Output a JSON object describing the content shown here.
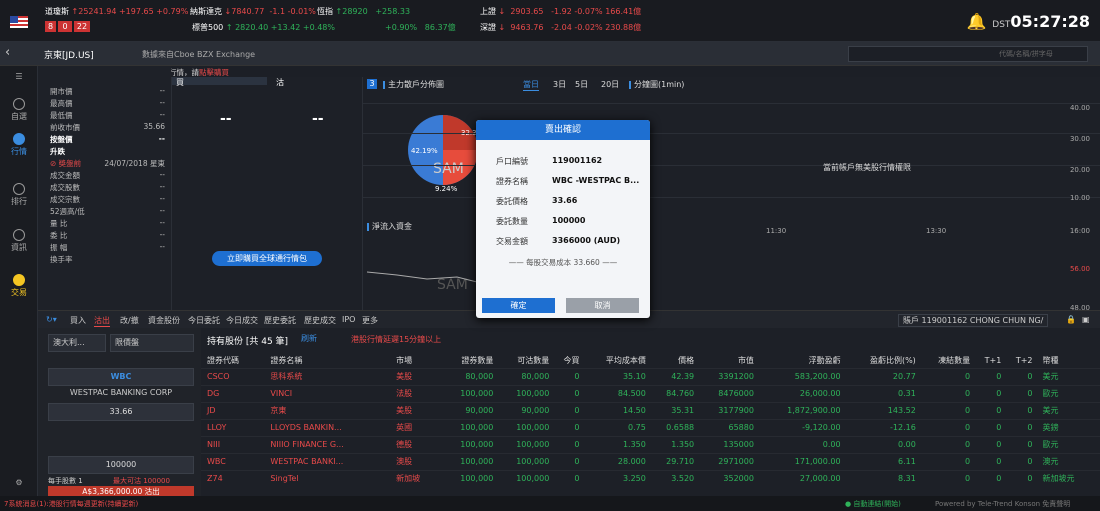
{
  "ticker": [
    {
      "name": "道瓊斯",
      "value": "25241.94",
      "chg": "+197.65",
      "pct": "+0.79%",
      "dir": "up"
    },
    {
      "name": "納斯達克",
      "value": "7840.77",
      "chg": "-1.1",
      "pct": "-0.01%",
      "dir": "dn"
    },
    {
      "name": "恆指",
      "value": "28920",
      "chg": "+258.33",
      "pct": "+0.90%",
      "dir": "up"
    },
    {
      "name": "上證",
      "value": "2903.65",
      "chg": "-1.92",
      "pct": "-0.07%",
      "amt": "166.41億",
      "dir": "dn"
    },
    {
      "name": "標普500",
      "value": "2820.40",
      "chg": "+13.42",
      "pct": "+0.48%",
      "dir": "up"
    },
    {
      "name": "",
      "value": "",
      "chg": "",
      "pct": "",
      "amt": "86.37億",
      "dir": "up"
    },
    {
      "name": "深證",
      "value": "9463.76",
      "chg": "-2.04",
      "pct": "-0.02%",
      "amt": "230.88億",
      "dir": "dn"
    }
  ],
  "counters": [
    "8",
    "0",
    "22"
  ],
  "clock": {
    "zone": "DST",
    "time": "05:27:28"
  },
  "stock": {
    "title": "京東[JD.US]",
    "source": "數據來自Cboe BZX Exchange",
    "search_placeholder": "代碼/名稱/拼字母"
  },
  "nav": [
    {
      "label": "自選"
    },
    {
      "label": "行情"
    },
    {
      "label": "排行"
    },
    {
      "label": "資訊"
    },
    {
      "label": "交易"
    }
  ],
  "warning": "當前帳戶無美股行情權限，如需實時行情，請",
  "warning_link": "點擊購買",
  "quote": [
    {
      "label": "開市價",
      "value": "--"
    },
    {
      "label": "最高價",
      "value": "--"
    },
    {
      "label": "最低價",
      "value": "--"
    },
    {
      "label": "前收市價",
      "value": "35.66"
    },
    {
      "label": "按盤價",
      "value": "--"
    },
    {
      "label": "升跌",
      "value": ""
    },
    {
      "label": "⊘ 獎盤前",
      "value": "24/07/2018 星東"
    },
    {
      "label": "成交金額",
      "value": "--"
    },
    {
      "label": "成交股數",
      "value": "--"
    },
    {
      "label": "成交宗數",
      "value": "--"
    },
    {
      "label": "52週高/低",
      "value": "--"
    },
    {
      "label": "量 比",
      "value": "--"
    },
    {
      "label": "委 比",
      "value": "--"
    },
    {
      "label": "振 幅",
      "value": "--"
    },
    {
      "label": "換手率",
      "value": ""
    }
  ],
  "book": {
    "buy": "買",
    "sell": "沽",
    "buy_price": "--",
    "sell_price": "--",
    "link": "立即購買全球通行情包"
  },
  "charts": {
    "main_title": "主力散戶分佈圖",
    "periods": [
      "當日",
      "3日",
      "5日",
      "20日"
    ],
    "flow_title": "分鐘圖(1min)",
    "pie": [
      {
        "label": "42.19%",
        "value": 42.19
      },
      {
        "label": "32.3",
        "value": 32.3
      },
      {
        "label": "9.24%",
        "value": 9.24
      }
    ],
    "net_title": "淨流入資金",
    "no_perm": "當前帳戶無美股行情權限",
    "yticks": [
      "40.00",
      "30.00",
      "20.00",
      "10.00",
      "16:00",
      "56.00",
      "48.00"
    ],
    "xticks": [
      "11:30",
      "13:30"
    ],
    "watermark": "SAM"
  },
  "modal": {
    "title": "賣出確認",
    "rows": [
      {
        "label": "戶口編號",
        "value": "119001162"
      },
      {
        "label": "證券名稱",
        "value": "WBC -WESTPAC B..."
      },
      {
        "label": "委託價格",
        "value": "33.66"
      },
      {
        "label": "委託數量",
        "value": "100000"
      },
      {
        "label": "交易金額",
        "value": "3366000 (AUD)"
      }
    ],
    "fee": "每股交易成本 33.660",
    "ok": "確定",
    "cancel": "取消"
  },
  "tabs": [
    "買入",
    "沽出",
    "改/撤",
    "資金股份",
    "今日委託",
    "今日成交",
    "歷史委託",
    "歷史成交",
    "IPO",
    "更多"
  ],
  "account": "賬戶 119001162 CHONG CHUN NG/",
  "entry": {
    "market": "澳大利...",
    "order_type": "限價盤",
    "code": "WBC",
    "name": "WESTPAC BANKING CORP",
    "price": "33.66",
    "qty": "100000",
    "lot": "每手股數 1",
    "max": "最大可沽 100000",
    "submit": "A$3,366,000.00 沽出"
  },
  "holdings": {
    "title": "持有股份 [共 45 筆]",
    "refresh": "刷新",
    "note": "港股行情延遲15分鐘以上",
    "headers": [
      "證券代碼",
      "證券名稱",
      "市場",
      "證券數量",
      "可沽數量",
      "今買",
      "平均成本價",
      "價格",
      "市值",
      "浮動盈虧",
      "盈虧比例(%)",
      "凍結數量",
      "T+1",
      "T+2",
      "幣種"
    ],
    "rows": [
      [
        "CSCO",
        "思科系統",
        "美股",
        "80,000",
        "80,000",
        "0",
        "35.10",
        "42.39",
        "3391200",
        "583,200.00",
        "20.77",
        "0",
        "0",
        "0",
        "美元"
      ],
      [
        "DG",
        "VINCI",
        "法股",
        "100,000",
        "100,000",
        "0",
        "84.500",
        "84.760",
        "8476000",
        "26,000.00",
        "0.31",
        "0",
        "0",
        "0",
        "歐元"
      ],
      [
        "JD",
        "京東",
        "美股",
        "90,000",
        "90,000",
        "0",
        "14.50",
        "35.31",
        "3177900",
        "1,872,900.00",
        "143.52",
        "0",
        "0",
        "0",
        "美元"
      ],
      [
        "LLOY",
        "LLOYDS BANKIN...",
        "英國",
        "100,000",
        "100,000",
        "0",
        "0.75",
        "0.6588",
        "65880",
        "-9,120.00",
        "-12.16",
        "0",
        "0",
        "0",
        "英鎊"
      ],
      [
        "NIII",
        "NIIIO FINANCE G...",
        "德股",
        "100,000",
        "100,000",
        "0",
        "1.350",
        "1.350",
        "135000",
        "0.00",
        "0.00",
        "0",
        "0",
        "0",
        "歐元"
      ],
      [
        "WBC",
        "WESTPAC BANKI...",
        "澳股",
        "100,000",
        "100,000",
        "0",
        "28.000",
        "29.710",
        "2971000",
        "171,000.00",
        "6.11",
        "0",
        "0",
        "0",
        "澳元"
      ],
      [
        "Z74",
        "SingTel",
        "新加坡",
        "100,000",
        "100,000",
        "0",
        "3.250",
        "3.520",
        "352000",
        "27,000.00",
        "8.31",
        "0",
        "0",
        "0",
        "新加坡元"
      ]
    ]
  },
  "footer": {
    "left": "7系統消息(1):港股行情每週更新(持續更新)",
    "status": "● 自動連結(開始)",
    "brand": "Powered by Tele-Trend Konson  免責聲明"
  }
}
